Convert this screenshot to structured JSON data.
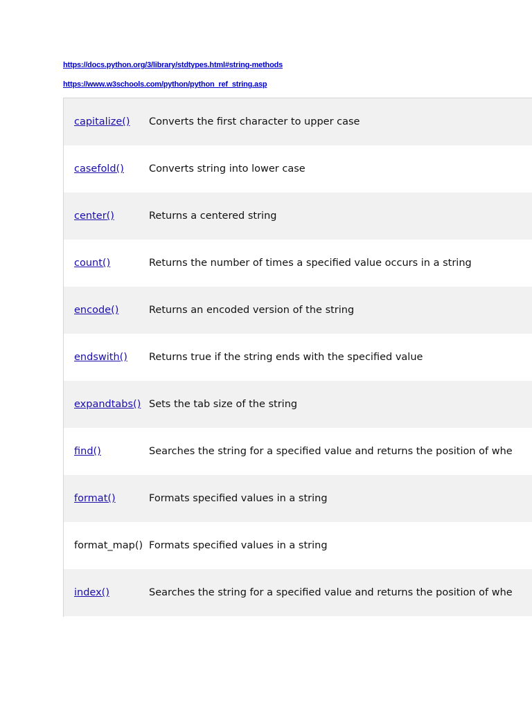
{
  "links": [
    "https://docs.python.org/3/library/stdtypes.html#string-methods",
    "https://www.w3schools.com/python/python_ref_string.asp"
  ],
  "colors": {
    "link": "#1a0dab",
    "header_link": "#0000cc",
    "row_shade": "#f1f1f1",
    "text": "#111111"
  },
  "methods": [
    {
      "name": "capitalize()",
      "description": "Converts the first character to upper case",
      "is_link": true
    },
    {
      "name": "casefold()",
      "description": "Converts string into lower case",
      "is_link": true
    },
    {
      "name": "center()",
      "description": "Returns a centered string",
      "is_link": true
    },
    {
      "name": "count()",
      "description": "Returns the number of times a specified value occurs in a string",
      "is_link": true
    },
    {
      "name": "encode()",
      "description": "Returns an encoded version of the string",
      "is_link": true
    },
    {
      "name": "endswith()",
      "description": "Returns true if the string ends with the specified value",
      "is_link": true
    },
    {
      "name": "expandtabs()",
      "description": "Sets the tab size of the string",
      "is_link": true
    },
    {
      "name": "find()",
      "description": "Searches the string for a specified value and returns the position of whe",
      "is_link": true
    },
    {
      "name": "format()",
      "description": "Formats specified values in a string",
      "is_link": true
    },
    {
      "name": "format_map()",
      "description": "Formats specified values in a string",
      "is_link": false
    },
    {
      "name": "index()",
      "description": "Searches the string for a specified value and returns the position of whe",
      "is_link": true
    }
  ]
}
